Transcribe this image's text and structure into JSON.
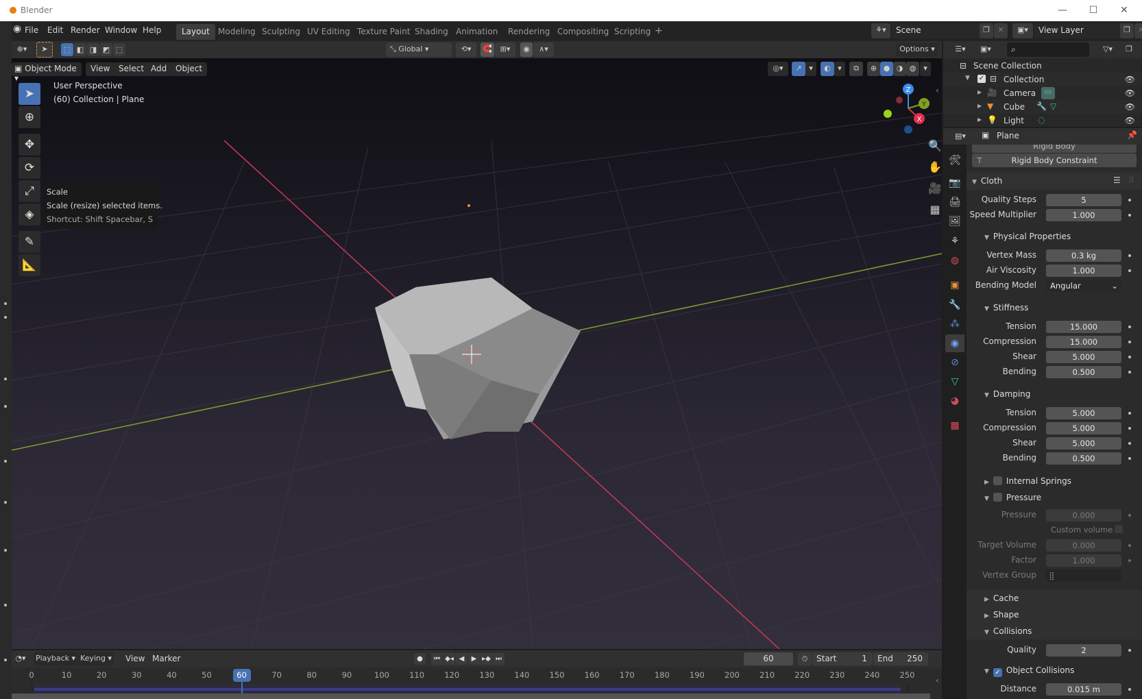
{
  "window": {
    "title": "Blender",
    "controls": {
      "minimize": "—",
      "maximize": "☐",
      "close": "✕"
    }
  },
  "menubar": {
    "menus": [
      "File",
      "Edit",
      "Render",
      "Window",
      "Help"
    ],
    "workspace_tabs": [
      "Layout",
      "Modeling",
      "Sculpting",
      "UV Editing",
      "Texture Paint",
      "Shading",
      "Animation",
      "Rendering",
      "Compositing",
      "Scripting"
    ],
    "active_tab": "Layout",
    "add_tab": "+",
    "scene": "Scene",
    "view_layer": "View Layer"
  },
  "tool_header": {
    "transform_orientation": "Global",
    "options_label": "Options"
  },
  "viewport_header": {
    "mode": "Object Mode",
    "menus": [
      "View",
      "Select",
      "Add",
      "Object"
    ]
  },
  "viewport": {
    "perspective_label": "User Perspective",
    "context_label": "(60) Collection | Plane",
    "gizmo_axes": {
      "x": "X",
      "y": "Y",
      "z": "Z"
    },
    "colors": {
      "x_axis": "#c03855",
      "y_axis": "#7a9a2e",
      "active_tool": "#4772b3"
    }
  },
  "tooltip": {
    "title": "Scale",
    "description": "Scale (resize) selected items.",
    "shortcut": "Shortcut: Shift Spacebar, S"
  },
  "outliner": {
    "root": "Scene Collection",
    "items": [
      {
        "name": "Collection",
        "type": "collection"
      },
      {
        "name": "Camera",
        "type": "camera"
      },
      {
        "name": "Cube",
        "type": "mesh"
      },
      {
        "name": "Light",
        "type": "light"
      }
    ]
  },
  "properties": {
    "object_name": "Plane",
    "physics_buttons": [
      "Rigid Body",
      "Rigid Body Constraint"
    ],
    "cloth": {
      "title": "Cloth",
      "quality_steps": {
        "label": "Quality Steps",
        "value": "5"
      },
      "speed_multiplier": {
        "label": "Speed Multiplier",
        "value": "1.000"
      },
      "physical": {
        "title": "Physical Properties",
        "vertex_mass": {
          "label": "Vertex Mass",
          "value": "0.3 kg"
        },
        "air_viscosity": {
          "label": "Air Viscosity",
          "value": "1.000"
        },
        "bending_model": {
          "label": "Bending Model",
          "value": "Angular"
        }
      },
      "stiffness": {
        "title": "Stiffness",
        "rows": [
          {
            "label": "Tension",
            "value": "15.000"
          },
          {
            "label": "Compression",
            "value": "15.000"
          },
          {
            "label": "Shear",
            "value": "5.000"
          },
          {
            "label": "Bending",
            "value": "0.500"
          }
        ]
      },
      "damping": {
        "title": "Damping",
        "rows": [
          {
            "label": "Tension",
            "value": "5.000"
          },
          {
            "label": "Compression",
            "value": "5.000"
          },
          {
            "label": "Shear",
            "value": "5.000"
          },
          {
            "label": "Bending",
            "value": "0.500"
          }
        ]
      },
      "internal_springs": {
        "title": "Internal Springs",
        "enabled": false
      },
      "pressure": {
        "title": "Pressure",
        "enabled": false,
        "pressure": {
          "label": "Pressure",
          "value": "0.000"
        },
        "custom_volume": {
          "label": "Custom volume",
          "checked": false
        },
        "target_volume": {
          "label": "Target Volume",
          "value": "0.000"
        },
        "factor": {
          "label": "Factor",
          "value": "1.000"
        },
        "vertex_group": {
          "label": "Vertex Group",
          "value": ""
        }
      },
      "cache": {
        "title": "Cache"
      },
      "shape": {
        "title": "Shape"
      },
      "collisions": {
        "title": "Collisions",
        "quality": {
          "label": "Quality",
          "value": "2"
        },
        "object_collisions": {
          "title": "Object Collisions",
          "enabled": true
        },
        "distance": {
          "label": "Distance",
          "value": "0.015 m"
        }
      }
    }
  },
  "timeline": {
    "menus": [
      "Playback",
      "Keying",
      "View",
      "Marker"
    ],
    "current_frame": "60",
    "start_label": "Start",
    "start": "1",
    "end_label": "End",
    "end": "250",
    "ticks": [
      "0",
      "10",
      "20",
      "30",
      "40",
      "50",
      "60",
      "70",
      "80",
      "90",
      "100",
      "110",
      "120",
      "130",
      "140",
      "150",
      "160",
      "170",
      "180",
      "190",
      "200",
      "210",
      "220",
      "230",
      "240",
      "250"
    ]
  }
}
